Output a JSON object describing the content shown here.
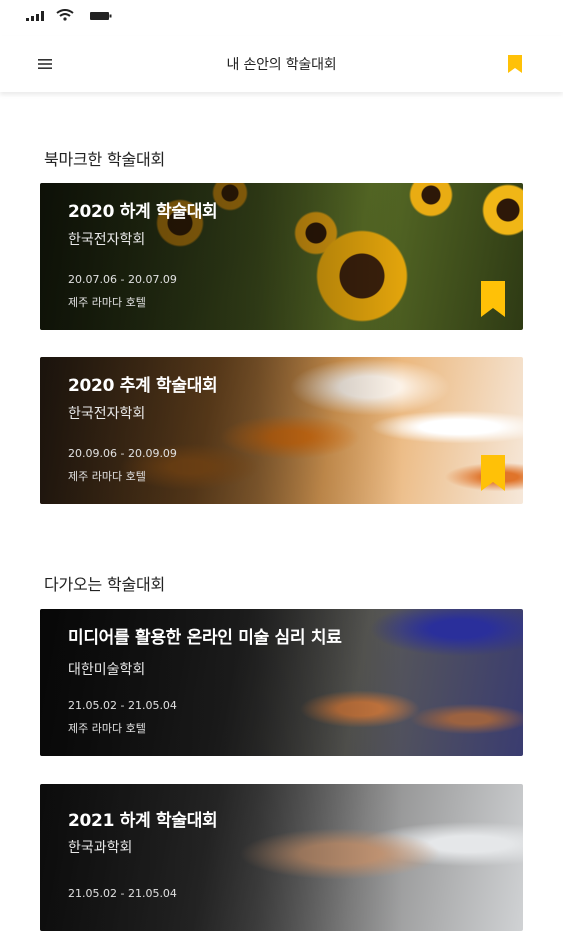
{
  "app": {
    "title": "내 손안의 학술대회",
    "accent_color": "#FFC107"
  },
  "sections": {
    "bookmarked": {
      "title": "북마크한 학술대회",
      "cards": [
        {
          "title": "2020 하계 학술대회",
          "org": "한국전자학회",
          "dates": "20.07.06 - 20.07.09",
          "venue": "제주 라마다 호텔",
          "bookmarked": true,
          "image": "sunflower-field"
        },
        {
          "title": "2020 추계 학술대회",
          "org": "한국전자학회",
          "dates": "20.09.06 - 20.09.09",
          "venue": "제주 라마다 호텔",
          "bookmarked": true,
          "image": "autumn-leaves"
        }
      ]
    },
    "upcoming": {
      "title": "다가오는 학술대회",
      "cards": [
        {
          "title": "미디어를 활용한 온라인 미술 심리 치료",
          "org": "대한미술학회",
          "dates": "21.05.02 - 21.05.04",
          "venue": "제주 라마다 호텔",
          "bookmarked": false,
          "image": "art-canvas"
        },
        {
          "title": "2021 하계 학술대회",
          "org": "한국과학회",
          "dates": "21.05.02 - 21.05.04",
          "venue": "",
          "bookmarked": false,
          "image": "hand-tablet"
        }
      ]
    }
  },
  "icons": {
    "status_signal": "signal-icon",
    "status_wifi": "wifi-icon",
    "status_battery": "battery-icon",
    "menu": "hamburger-menu-icon",
    "bookmark": "bookmark-icon"
  }
}
